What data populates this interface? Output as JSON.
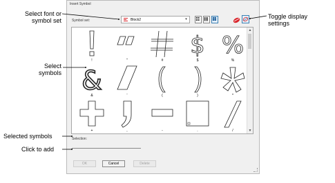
{
  "dialog": {
    "title": "Insert Symbol",
    "symbol_set_label": "Symbol set:",
    "symbol_set_value": "Block2",
    "selection_label": "Selection:",
    "selection_value": "",
    "buttons": {
      "ok": "OK",
      "cancel": "Cancel",
      "delete": "Delete"
    }
  },
  "symbols": [
    {
      "glyph": "!",
      "caption": "!"
    },
    {
      "glyph": "\"",
      "caption": "\""
    },
    {
      "glyph": "#",
      "caption": "#"
    },
    {
      "glyph": "$",
      "caption": "$"
    },
    {
      "glyph": "%",
      "caption": "%"
    },
    {
      "glyph": "&",
      "caption": "&"
    },
    {
      "glyph": "'",
      "caption": "'"
    },
    {
      "glyph": "(",
      "caption": "("
    },
    {
      "glyph": ")",
      "caption": ")"
    },
    {
      "glyph": "*",
      "caption": "*"
    },
    {
      "glyph": "+",
      "caption": "+"
    },
    {
      "glyph": ",",
      "caption": ","
    },
    {
      "glyph": "-",
      "caption": "-"
    },
    {
      "glyph": ".",
      "caption": "."
    },
    {
      "glyph": "/",
      "caption": "/"
    }
  ],
  "callouts": {
    "select_font": "Select font or\nsymbol set",
    "toggle_display": "Toggle display\nsettings",
    "select_symbols": "Select\nsymbols",
    "selected_symbols": "Selected symbols",
    "click_to_add": "Click to add"
  },
  "colors": {
    "accent": "#3c7fb1",
    "font_icon": "#d9262c"
  }
}
